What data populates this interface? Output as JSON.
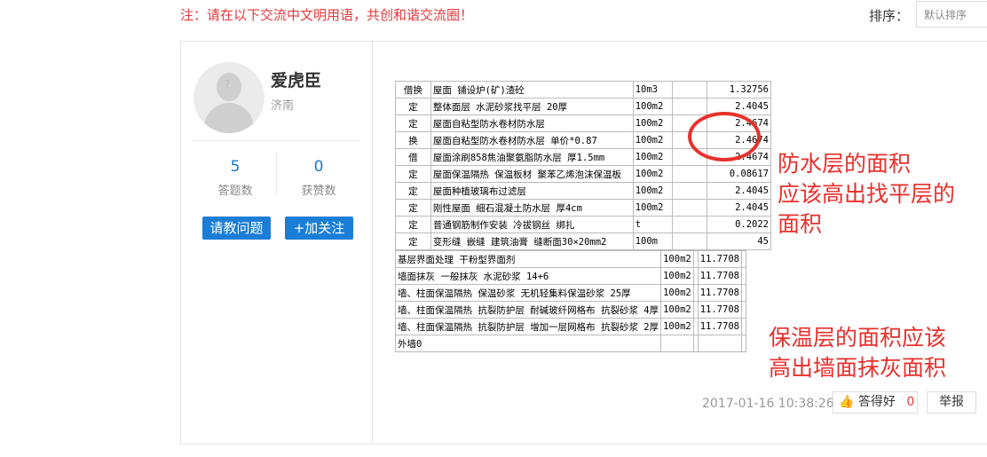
{
  "header": {
    "notice": "注：请在以下交流中文明用语，共创和谐交流圈！",
    "sort_label": "排序：",
    "sort_value": "默认排序"
  },
  "user": {
    "name": "爱虎臣",
    "city": "济南",
    "answers_count": "5",
    "answers_label": "答题数",
    "likes_count": "0",
    "likes_label": "获赞数",
    "ask_button": "请教问题",
    "follow_button": "+加关注"
  },
  "table_top": [
    [
      "借换",
      "屋面 铺设炉(矿)渣砼",
      "10m3",
      "",
      "1.32756"
    ],
    [
      "定",
      "整体面层 水泥砂浆找平层 20厚",
      "100m2",
      "",
      "2.4045"
    ],
    [
      "定",
      "屋面自粘型防水卷材防水层",
      "100m2",
      "",
      "2.4674"
    ],
    [
      "换",
      "屋面自粘型防水卷材防水层 单价*0.87",
      "100m2",
      "",
      "2.4674"
    ],
    [
      "借",
      "屋面涂刷858焦油聚氨脂防水层 厚1.5mm",
      "100m2",
      "",
      "2.4674"
    ],
    [
      "定",
      "屋面保温隔热 保温板材 聚苯乙烯泡沫保温板",
      "100m2",
      "",
      "0.08617"
    ],
    [
      "定",
      "屋面种植玻璃布过滤层",
      "100m2",
      "",
      "2.4045"
    ],
    [
      "定",
      "刚性屋面 细石混凝土防水层 厚4cm",
      "100m2",
      "",
      "2.4045"
    ],
    [
      "定",
      "普通钢筋制作安装 冷拔钢丝 绑扎",
      "t",
      "",
      "0.2022"
    ],
    [
      "定",
      "变形缝 嵌缝 建筑油膏 缝断面30×20mm2",
      "100m",
      "",
      "45"
    ]
  ],
  "table_bottom": [
    [
      "基层界面处理 干粉型界面剂",
      "100m2",
      "",
      "11.7708",
      ""
    ],
    [
      "墙面抹灰 一般抹灰 水泥砂浆 14+6",
      "100m2",
      "",
      "11.7708",
      ""
    ],
    [
      "墙、柱面保温隔热 保温砂浆 无机轻集料保温砂浆 25厚",
      "100m2",
      "",
      "11.7708",
      ""
    ],
    [
      "墙、柱面保温隔热 抗裂防护层 耐碱玻纤网格布 抗裂砂浆 4厚",
      "100m2",
      "",
      "11.7708",
      ""
    ],
    [
      "墙、柱面保温隔热 抗裂防护层 增加一层网格布 抗裂砂浆 2厚",
      "100m2",
      "",
      "11.7708",
      ""
    ],
    [
      "外墙0",
      "",
      "",
      "",
      ""
    ]
  ],
  "annotations": {
    "top_line1": "防水层的面积",
    "top_line2": "应该高出找平层的",
    "top_line3": "面积",
    "bottom_line1": "保温层的面积应该",
    "bottom_line2": "高出墙面抹灰面积"
  },
  "footer": {
    "timestamp": "2017-01-16 10:38:26",
    "like_label": "答得好",
    "like_count": "0",
    "report_label": "举报"
  },
  "colors": {
    "accent": "#1a7ed6",
    "notice": "#e4393c",
    "annotation": "#e8302c"
  }
}
